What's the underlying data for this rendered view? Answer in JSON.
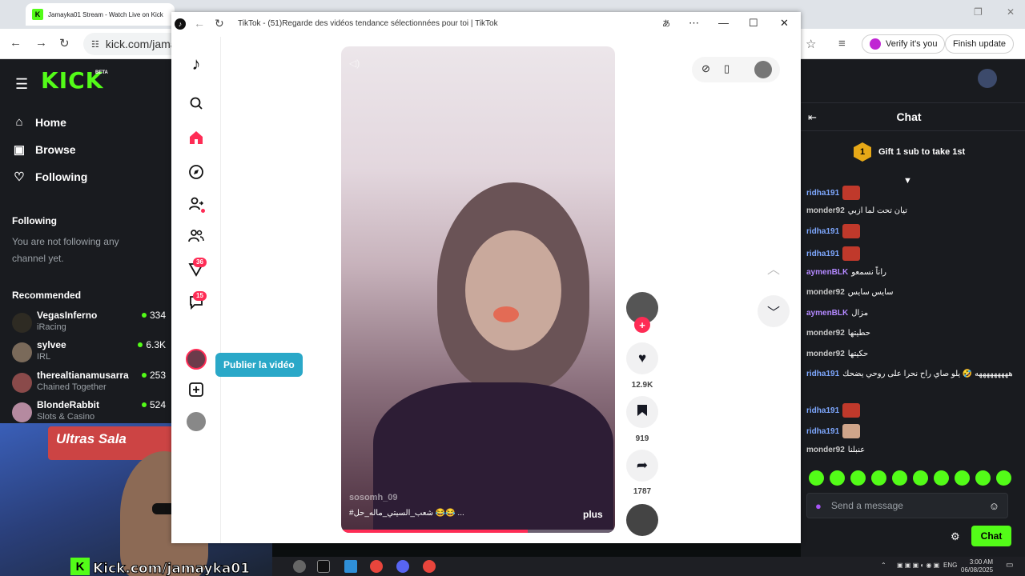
{
  "bg_browser": {
    "tab_title": "Jamayka01 Stream - Watch Live on Kick",
    "url": "kick.com/jamay",
    "verify_label": "Verify it's you",
    "update_label": "Finish update"
  },
  "kick": {
    "logo": "KICK",
    "beta": "BETA",
    "nav": [
      {
        "label": "Home",
        "icon": "home-icon"
      },
      {
        "label": "Browse",
        "icon": "browse-icon"
      },
      {
        "label": "Following",
        "icon": "heart-icon"
      }
    ],
    "following_title": "Following",
    "following_note": "You are not following any channel yet.",
    "recommended_title": "Recommended",
    "recommended": [
      {
        "name": "VegasInferno",
        "category": "iRacing",
        "viewers": "334"
      },
      {
        "name": "sylvee",
        "category": "IRL",
        "viewers": "6.3K"
      },
      {
        "name": "therealtianamusarra",
        "category": "Chained Together",
        "viewers": "253"
      },
      {
        "name": "BlondeRabbit",
        "category": "Slots & Casino",
        "viewers": "524"
      }
    ]
  },
  "chat": {
    "title": "Chat",
    "gift_rank": "1",
    "gift_text": "Gift 1 sub to take 1st",
    "messages": [
      {
        "user": "ridha191",
        "color": "#7ea8ff",
        "text": ""
      },
      {
        "user": "monder92",
        "color": "#c8c8c8",
        "text": "تيان تحت لما ازبي"
      },
      {
        "user": "ridha191",
        "color": "#7ea8ff",
        "text": ""
      },
      {
        "user": "ridha191",
        "color": "#7ea8ff",
        "text": ""
      },
      {
        "user": "aymenBLK",
        "color": "#b388ff",
        "text": "راناً نسمعو"
      },
      {
        "user": "monder92",
        "color": "#c8c8c8",
        "text": "سايس سايس"
      },
      {
        "user": "aymenBLK",
        "color": "#b388ff",
        "text": "مزال"
      },
      {
        "user": "monder92",
        "color": "#c8c8c8",
        "text": "حطيتها"
      },
      {
        "user": "monder92",
        "color": "#c8c8c8",
        "text": "حكيتها"
      },
      {
        "user": "ridha191",
        "color": "#7ea8ff",
        "text": "هههههههههه 🤣 يلو صاي راح نحرا على روحي يضحك"
      },
      {
        "user": "ridha191",
        "color": "#7ea8ff",
        "text": ""
      },
      {
        "user": "ridha191",
        "color": "#7ea8ff",
        "text": ""
      },
      {
        "user": "monder92",
        "color": "#c8c8c8",
        "text": "عنبلنا"
      }
    ],
    "input_placeholder": "Send a message",
    "send_label": "Chat"
  },
  "webcam": {
    "banner": "Ultras Sala",
    "url_text": "Kick.com/jamayka01"
  },
  "taskbar": {
    "lang": "ENG",
    "time": "3:00 AM",
    "date": "06/08/2025"
  },
  "tiktok": {
    "window_title": "TikTok - (51)Regarde des vidéos tendance sélectionnées pour toi | TikTok",
    "publish_label": "Publier la vidéo",
    "rail_badges": {
      "explore": "36",
      "inbox": "15"
    },
    "video": {
      "username": "sosomh_09",
      "caption": "#شعب_السيتي_ماله_حل 😂😂 ...",
      "more": "plus",
      "progress": 0.68
    },
    "actions": {
      "likes": "12.9K",
      "saves": "919",
      "shares": "1787"
    }
  }
}
